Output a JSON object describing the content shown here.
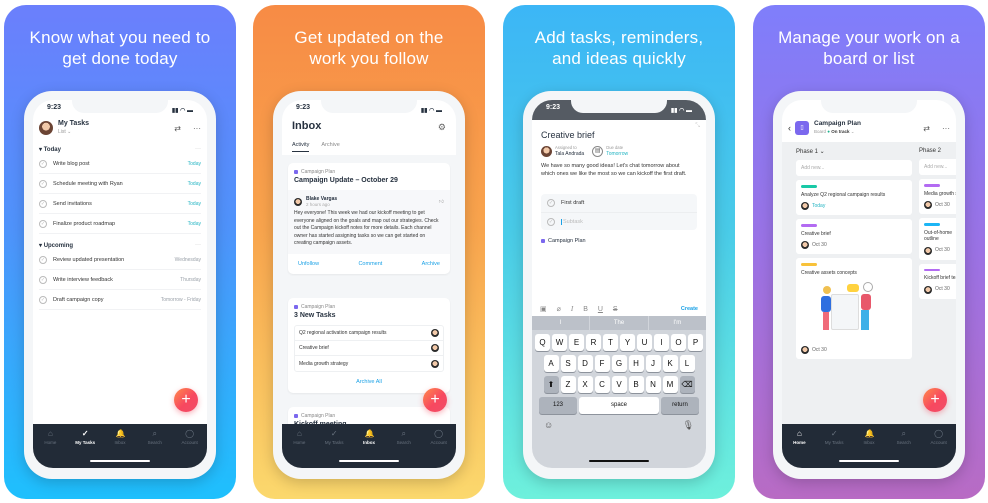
{
  "panels": [
    {
      "headline": "Know what you need to get done today",
      "time": "9:23",
      "header": {
        "title": "My Tasks",
        "subtitle": "List ⌄",
        "filter_icon": "⇄",
        "more_icon": "···"
      },
      "sections": [
        {
          "title": "Today",
          "tasks": [
            {
              "name": "Write blog post",
              "due": "Today"
            },
            {
              "name": "Schedule meeting with Ryan",
              "due": "Today"
            },
            {
              "name": "Send invitations",
              "due": "Today"
            },
            {
              "name": "Finalize product roadmap",
              "due": "Today"
            }
          ]
        },
        {
          "title": "Upcoming",
          "tasks": [
            {
              "name": "Review updated presentation",
              "due": "Wednesday"
            },
            {
              "name": "Write interview feedback",
              "due": "Thursday"
            },
            {
              "name": "Draft campaign copy",
              "due": "Tomorrow - Friday"
            }
          ]
        }
      ],
      "active_tab": "My Tasks"
    },
    {
      "headline": "Get updated on the work you follow",
      "time": "9:23",
      "title": "Inbox",
      "tabs": [
        "Activity",
        "Archive"
      ],
      "card1": {
        "project": "Campaign Plan",
        "title": "Campaign Update – October 29",
        "author": "Blake Vargas",
        "time_ago": "2 hours ago",
        "body": "Hey everyone! This week we had our kickoff meeting to get everyone aligned on the goals and map out our strategies. Check out the Campaign kickoff notes for more details. Each channel owner has started assigning tasks so we can get started on creating campaign assets.",
        "actions": [
          "Unfollow",
          "Comment",
          "Archive"
        ]
      },
      "card2": {
        "project": "Campaign Plan",
        "title": "3 New Tasks",
        "tasks": [
          "Q2 regional activation campaign results",
          "Creative brief",
          "Media growth strategy"
        ],
        "action": "Archive All"
      },
      "card3": {
        "project": "Campaign Plan",
        "title": "Kickoff meeting"
      },
      "active_tab": "Inbox"
    },
    {
      "headline": "Add tasks, reminders, and ideas quickly",
      "time": "9:23",
      "title": "Creative brief",
      "assigned_label": "Assigned to",
      "assignee": "Tala Andrada",
      "due_label": "Due date",
      "due": "Tomorrow",
      "description": "We have so many good ideas! Let's chat tomorrow about which ones we like the most so we can kickoff the first draft.",
      "subtasks": [
        "First draft"
      ],
      "subtask_placeholder": "Subtask",
      "project": "Campaign Plan",
      "create_label": "Create",
      "suggestions": [
        "I",
        "The",
        "I'm"
      ],
      "keyboard": {
        "row1": [
          "Q",
          "W",
          "E",
          "R",
          "T",
          "Y",
          "U",
          "I",
          "O",
          "P"
        ],
        "row2": [
          "A",
          "S",
          "D",
          "F",
          "G",
          "H",
          "J",
          "K",
          "L"
        ],
        "row3": [
          "Z",
          "X",
          "C",
          "V",
          "B",
          "N",
          "M"
        ],
        "numbers": "123",
        "space": "space",
        "return": "return"
      }
    },
    {
      "headline": "Manage your work on a board or list",
      "title": "Campaign Plan",
      "view": "Board",
      "status": "On track",
      "columns": [
        {
          "name": "Phase 1 ⌄",
          "add": "Add new...",
          "cards": [
            {
              "title": "Analyze Q2 regional campaign results",
              "due": "Today",
              "color": "#19c9a6"
            },
            {
              "title": "Creative brief",
              "due": "Oct 30",
              "color": "#b36bf2"
            },
            {
              "title": "Creative assets concepts",
              "due": "Oct 30",
              "color": "#f8c23a"
            }
          ]
        },
        {
          "name": "Phase 2",
          "add": "Add new...",
          "cards": [
            {
              "title": "Media growth strategy",
              "due": "Oct 30",
              "color": "#b36bf2"
            },
            {
              "title": "Out-of-home outline",
              "due": "Oct 30",
              "color": "#1cb5f5"
            },
            {
              "title": "Kickoff brief team",
              "due": "Oct 30",
              "color": "#b36bf2"
            }
          ]
        }
      ],
      "active_tab": "Home"
    }
  ],
  "tabbar": [
    {
      "label": "Home",
      "icon": "⌂"
    },
    {
      "label": "My Tasks",
      "icon": "✓"
    },
    {
      "label": "Inbox",
      "icon": "🔔"
    },
    {
      "label": "Search",
      "icon": "⌕"
    },
    {
      "label": "Account",
      "icon": "◯"
    }
  ],
  "fab_icon": "+"
}
